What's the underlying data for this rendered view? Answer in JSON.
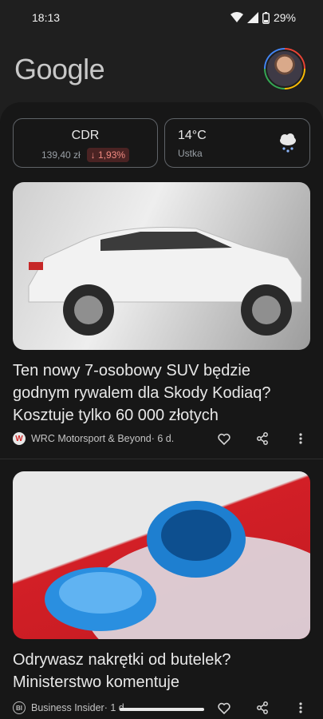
{
  "status_bar": {
    "time": "18:13",
    "battery": "29%",
    "icons": [
      "wifi-icon",
      "signal-icon",
      "battery-icon"
    ]
  },
  "header": {
    "logo": "Google",
    "avatar": "profile-avatar"
  },
  "widgets": {
    "stock": {
      "name": "CDR",
      "price": "139,40 zł",
      "change": "↓ 1,93%"
    },
    "weather": {
      "temp": "14°C",
      "location": "Ustka",
      "icon": "rain-cloud-icon"
    }
  },
  "articles": [
    {
      "title": "Ten nowy 7-osobowy SUV będzie godnym rywalem dla Skody Kodiaq? Kosztuje tylko 60 000 złotych",
      "source": "WRC Motorsport & Beyond",
      "age": " · 6 d.",
      "source_icon": "W",
      "image": "white SUV side view"
    },
    {
      "title": "Odrywasz nakrętki od butelek? Ministerstwo komentuje",
      "source": "Business Insider",
      "age": " · 1 d",
      "source_icon": "BI",
      "image": "blue bottle cap"
    }
  ],
  "colors": {
    "background": "#1f1f1f",
    "feed": "#171717",
    "negative": "#f28b82"
  }
}
